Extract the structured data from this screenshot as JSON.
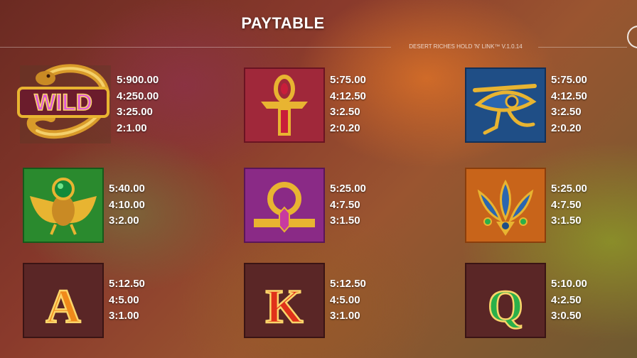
{
  "header": {
    "title": "PAYTABLE",
    "version": "DESERT RICHES HOLD 'N' LINK™ V.1.0.14"
  },
  "symbols": [
    {
      "icon": "wild-snake-icon",
      "label": "WILD",
      "pays": [
        "5:900.00",
        "4:250.00",
        "3:25.00",
        "2:1.00"
      ]
    },
    {
      "icon": "ankh-icon",
      "pays": [
        "5:75.00",
        "4:12.50",
        "3:2.50",
        "2:0.20"
      ]
    },
    {
      "icon": "eye-of-horus-icon",
      "pays": [
        "5:75.00",
        "4:12.50",
        "3:2.50",
        "2:0.20"
      ]
    },
    {
      "icon": "scarab-icon",
      "pays": [
        "5:40.00",
        "4:10.00",
        "3:2.00"
      ]
    },
    {
      "icon": "shen-ring-icon",
      "pays": [
        "5:25.00",
        "4:7.50",
        "3:1.50"
      ]
    },
    {
      "icon": "lotus-icon",
      "pays": [
        "5:25.00",
        "4:7.50",
        "3:1.50"
      ]
    },
    {
      "icon": "letter-a-icon",
      "letter": "A",
      "pays": [
        "5:12.50",
        "4:5.00",
        "3:1.00"
      ]
    },
    {
      "icon": "letter-k-icon",
      "letter": "K",
      "pays": [
        "5:12.50",
        "4:5.00",
        "3:1.00"
      ]
    },
    {
      "icon": "letter-q-icon",
      "letter": "Q",
      "pays": [
        "5:10.00",
        "4:2.50",
        "3:0.50"
      ]
    }
  ],
  "colors": {
    "ankh_bg": "#a0283a",
    "eye_bg": "#1f4e86",
    "scarab_bg": "#2a8a2e",
    "ring_bg": "#8a2a86",
    "lotus_bg": "#c8641a",
    "royal_bg": "#5a2626",
    "gold": "#e8b431"
  }
}
